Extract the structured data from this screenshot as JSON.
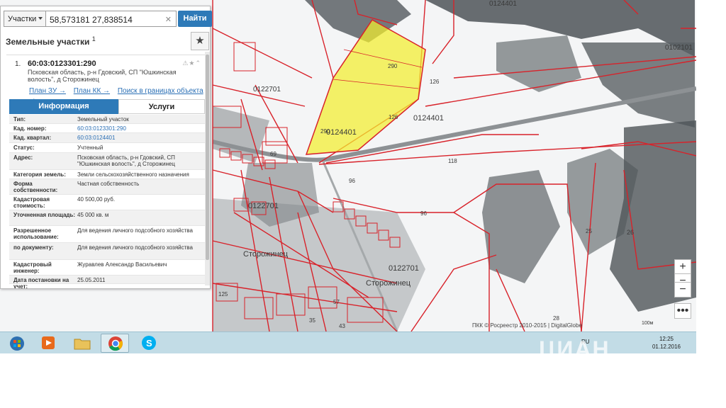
{
  "search": {
    "layer": "Участки",
    "query": "58,573181 27,838514",
    "clear_glyph": "✕",
    "button": "Найти"
  },
  "panel": {
    "title": "Земельные участки",
    "count": "1",
    "star_glyph": "★"
  },
  "result": {
    "index": "1.",
    "cad_number": "60:03:0123301:290",
    "tools": "⚠★⌃",
    "address": "Псковская область, р-н Гдовский, СП \"Юшкинская волость\", д Сторожинец",
    "links": [
      "План ЗУ →",
      "План КК →",
      "Поиск в границах объекта →"
    ],
    "tabs": [
      "Информация",
      "Услуги"
    ],
    "attrs": [
      {
        "key": "Тип:",
        "value": "Земельный участок"
      },
      {
        "key": "Кад. номер:",
        "value": "60:03:0123301:290"
      },
      {
        "key": "Кад. квартал:",
        "value": "60:03:0124401"
      },
      {
        "key": "Статус:",
        "value": "Учтенный"
      },
      {
        "key": "Адрес:",
        "value": "Псковская область, р-н Гдовский, СП \"Юшкинская волость\", д Сторожинец"
      },
      {
        "key": "Категория земель:",
        "value": "Земли сельскохозяйственного назначения"
      },
      {
        "key": "Форма собственности:",
        "value": "Частная собственность"
      },
      {
        "key": "Кадастровая стоимость:",
        "value": "40 500,00 руб."
      },
      {
        "key": "Уточненная площадь:",
        "value": "45 000 кв. м"
      },
      {
        "key": "Разрешенное использование:",
        "value": "Для ведения личного подсобного хозяйства"
      },
      {
        "key": "по документу:",
        "value": "Для ведения личного подсобного хозяйства"
      },
      {
        "key": "Кадастровый инженер:",
        "value": "Журавлев Александр Васильевич"
      },
      {
        "key": "Дата постановки на учет:",
        "value": "25.05.2011"
      }
    ]
  },
  "map": {
    "labels": {
      "q0102101": "0102101",
      "q0124401a": "0124401",
      "q0124401b": "0124401",
      "q0124401c": "0124401",
      "q0122701a": "0122701",
      "q0122701b": "0122701",
      "q0122701c": "0122701",
      "village": "Сторожинец",
      "lot290": "290",
      "lot126": "126",
      "lot118": "118",
      "lot96": "96",
      "lot69": "69",
      "lot25": "25",
      "lot26": "26",
      "lot57": "57",
      "lot35": "35",
      "lot43": "43",
      "lot28": "28",
      "lot125": "125"
    },
    "attribution": "ПКК © Росреестр 2010-2015 | DigitalGlobe",
    "scale": "100м",
    "zoom_in": "+",
    "zoom_mid": "−",
    "zoom_out": "−",
    "more": "•••"
  },
  "taskbar": {
    "lang": "RU",
    "time": "12:25",
    "date": "01.12.2016"
  },
  "watermark": "ЦИАН"
}
